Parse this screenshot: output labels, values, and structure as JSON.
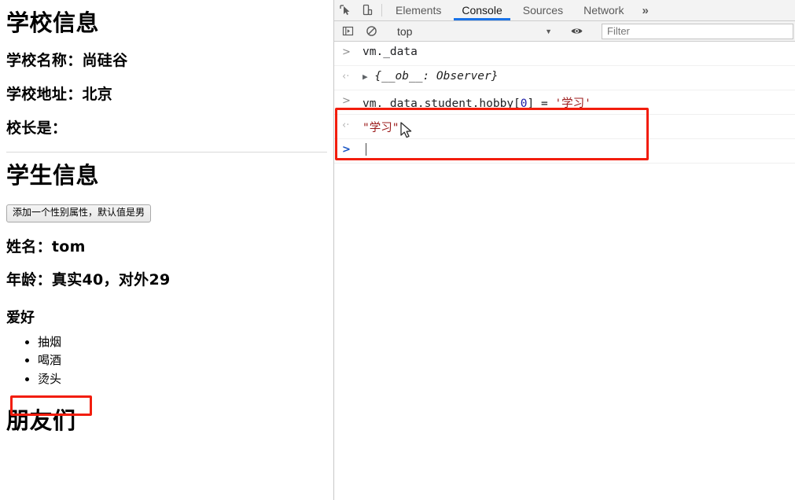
{
  "webpage": {
    "school": {
      "heading": "学校信息",
      "name_line": "学校名称：尚硅谷",
      "address_line": "学校地址：北京",
      "principal_line": "校长是："
    },
    "student": {
      "heading": "学生信息",
      "add_gender_button": "添加一个性别属性，默认值是男",
      "name_line": "姓名：tom",
      "age_line": "年龄：真实40，对外29",
      "hobby_heading": "爱好",
      "hobbies": [
        "抽烟",
        "喝酒",
        "烫头"
      ],
      "friends_heading": "朋友们"
    }
  },
  "devtools": {
    "toolbar_icons": {
      "inspect": "inspect-element-icon",
      "device": "device-toolbar-icon"
    },
    "tabs": [
      {
        "label": "Elements",
        "active": false
      },
      {
        "label": "Console",
        "active": true
      },
      {
        "label": "Sources",
        "active": false
      },
      {
        "label": "Network",
        "active": false
      }
    ],
    "tabs_overflow": "»",
    "console_toolbar": {
      "sidebar_toggle_icon": "console-sidebar-icon",
      "clear_icon": "clear-console-icon",
      "context_value": "top",
      "context_caret": "▼",
      "eye_icon": "live-expression-eye-icon",
      "filter_placeholder": "Filter"
    },
    "messages": [
      {
        "gutter": ">",
        "type": "input",
        "text": "vm._data"
      },
      {
        "gutter": "‹·",
        "type": "output",
        "expander": "▶",
        "text": "{__ob__: Observer}"
      },
      {
        "gutter": ">",
        "type": "input",
        "code_prefix": "vm._data.student.hobby[",
        "code_index": "0",
        "code_mid": "] = ",
        "code_string": "'学习'"
      },
      {
        "gutter": "‹·",
        "type": "output",
        "result_string": "\"学习\""
      }
    ],
    "prompt": ">"
  },
  "annotations": {
    "highlight_color": "#f21d0d",
    "hobby_box": "抽烟",
    "console_box": "vm._data.student.hobby[0] = '学习'"
  }
}
